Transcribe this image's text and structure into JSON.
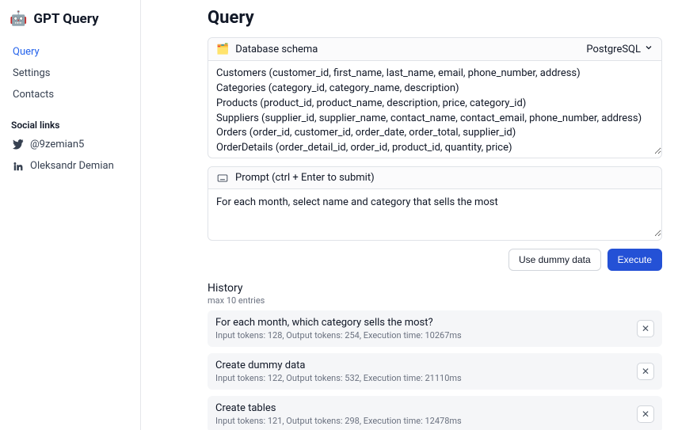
{
  "brand": {
    "emoji": "🤖",
    "title": "GPT Query"
  },
  "nav": {
    "items": [
      {
        "label": "Query",
        "active": true
      },
      {
        "label": "Settings",
        "active": false
      },
      {
        "label": "Contacts",
        "active": false
      }
    ]
  },
  "social": {
    "heading": "Social links",
    "items": [
      {
        "label": "@9zemian5",
        "icon": "twitter"
      },
      {
        "label": "Oleksandr Demian",
        "icon": "linkedin"
      }
    ]
  },
  "page": {
    "title": "Query"
  },
  "schema": {
    "icon": "🗂️",
    "head_label": "Database schema",
    "db_options_selected": "PostgreSQL",
    "value": "Customers (customer_id, first_name, last_name, email, phone_number, address)\nCategories (category_id, category_name, description)\nProducts (product_id, product_name, description, price, category_id)\nSuppliers (supplier_id, supplier_name, contact_name, contact_email, phone_number, address)\nOrders (order_id, customer_id, order_date, order_total, supplier_id)\nOrderDetails (order_detail_id, order_id, product_id, quantity, price)"
  },
  "prompt": {
    "head_label": "Prompt (ctrl + Enter to submit)",
    "value": "For each month, select name and category that sells the most"
  },
  "actions": {
    "dummy": "Use dummy data",
    "execute": "Execute"
  },
  "history": {
    "title": "History",
    "subtitle": "max 10 entries",
    "items": [
      {
        "query": "For each month, which category sells the most?",
        "meta": "Input tokens: 128, Output tokens: 254, Execution time: 10267ms"
      },
      {
        "query": "Create dummy data",
        "meta": "Input tokens: 122, Output tokens: 532, Execution time: 21110ms"
      },
      {
        "query": "Create tables",
        "meta": "Input tokens: 121, Output tokens: 298, Execution time: 12478ms"
      }
    ],
    "delete_symbol": "✕"
  }
}
